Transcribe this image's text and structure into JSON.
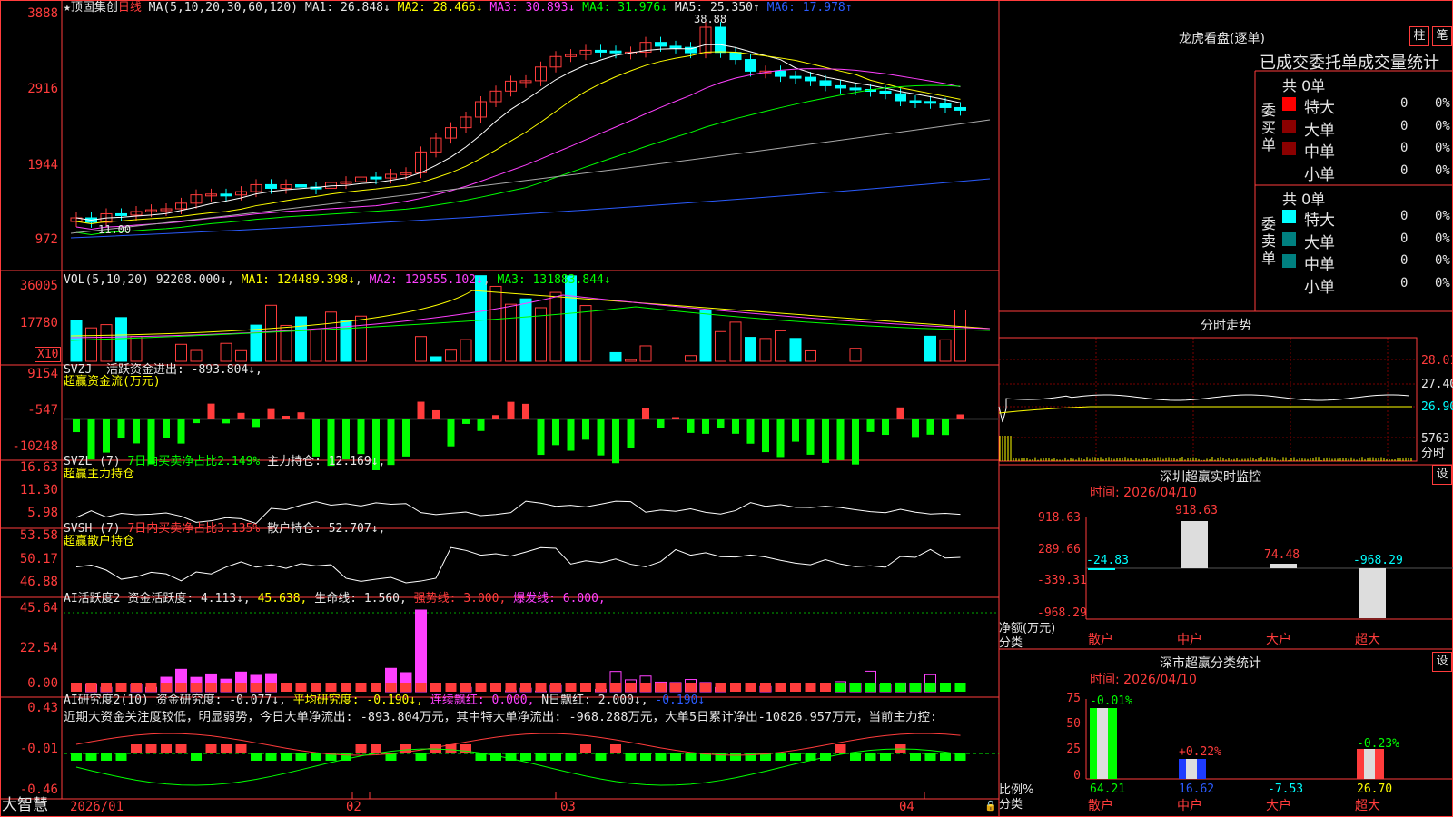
{
  "panel1": {
    "stock": "★顶固集创",
    "period": "日线",
    "ma_params": "MA(5,10,20,30,60,120)",
    "ma1": "MA1: 26.848↓",
    "ma2": "MA2: 28.466↓",
    "ma3": "MA3: 30.893↓",
    "ma4": "MA4: 31.976↓",
    "ma5": "MA5: 25.350↑",
    "ma6": "MA6: 17.978↑",
    "hi_mark": "38.88",
    "lo_mark": "11.00",
    "yticks": [
      "3888",
      "2916",
      "1944",
      "972"
    ]
  },
  "vol": {
    "label": "VOL(5,10,20)",
    "val": "92208.000↓",
    "ma1": "MA1: 124489.398↓",
    "ma2": "MA2: 129555.102↓",
    "ma3": "MA3: 131883.844↓",
    "yticks": [
      "36005",
      "17780"
    ],
    "unit": "X10"
  },
  "svzj": {
    "label": "SVZJ",
    "desc": "活跃资金进出: -893.804↓,",
    "sub": "超赢资金流(万元)",
    "yticks": [
      "9154",
      "-547",
      "-10248"
    ]
  },
  "svzl": {
    "label": "SVZL (7)",
    "desc1": "7日内买卖净占比2.149%",
    "desc2": "主力持仓: 12.169↓,",
    "sub": "超赢主力持仓",
    "yticks": [
      "16.63",
      "11.30",
      "5.98"
    ]
  },
  "svsh": {
    "label": "SVSH (7)",
    "desc1": "7日内买卖净占比3.135%",
    "desc2": "散户持仓: 52.707↓,",
    "sub": "超赢散户持仓",
    "yticks": [
      "53.58",
      "50.17",
      "46.88"
    ]
  },
  "ai1": {
    "label": "AI活跃度2",
    "d1": "资金活跃度: 4.113↓,",
    "d2": "45.638,",
    "d3": "生命线: 1.560,",
    "d4": "强势线: 3.000,",
    "d5": "爆发线: 6.000,",
    "yticks": [
      "45.64",
      "22.54",
      "0.00"
    ]
  },
  "ai2": {
    "label": "AI研究度2(10)",
    "d1": "资金研究度: -0.077↓,",
    "d2": "平均研究度: -0.190↓,",
    "d3": "连续飘红: 0.000,",
    "d4": "N日飘红: 2.000↓,",
    "d5": "-0.190↓",
    "comment": "近期大资金关注度较低，明显弱势，今日大单净流出: -893.804万元，其中特大单净流出: -968.288万元，大单5日累计净出-10826.957万元，当前主力控:",
    "yticks": [
      "0.43",
      "-0.01",
      "-0.46"
    ]
  },
  "xaxis": {
    "labels": [
      "2026/01",
      "02",
      "03",
      "04"
    ]
  },
  "brand": "大智慧",
  "right": {
    "lhb": {
      "title": "龙虎看盘(逐单)",
      "btn1": "柱",
      "btn2": "笔",
      "tabs": "已成交委托单成交量统计",
      "buy_total": "共 0单",
      "sell_total": "共 0单",
      "buy_label": "委买单",
      "sell_label": "委卖单",
      "rows": [
        {
          "name": "特大",
          "v": "0",
          "p": "0%"
        },
        {
          "name": "大单",
          "v": "0",
          "p": "0%"
        },
        {
          "name": "中单",
          "v": "0",
          "p": "0%"
        },
        {
          "name": "小单",
          "v": "0",
          "p": "0%"
        }
      ]
    },
    "intraday": {
      "title": "分时走势",
      "p1": "28.01",
      "p2": "27.40",
      "p3": "26.90",
      "vol": "5763",
      "volunit": "分时"
    },
    "mon": {
      "title": "深圳超赢实时监控",
      "btn": "设",
      "time": "时间: 2026/04/10",
      "yticks": [
        "918.63",
        "289.66",
        "-339.31",
        "-968.29"
      ],
      "ylabel": "净额(万元)",
      "xlabel": "分类",
      "cats": [
        "散户",
        "中户",
        "大户",
        "超大"
      ],
      "vals": [
        "-24.83",
        "918.63",
        "74.48",
        "-968.29"
      ]
    },
    "cls": {
      "title": "深市超赢分类统计",
      "btn": "设",
      "time": "时间: 2026/04/10",
      "yticks": [
        "75",
        "50",
        "25",
        "0"
      ],
      "ylabel": "比例%",
      "xlabel": "分类",
      "cats": [
        "散户",
        "中户",
        "大户",
        "超大"
      ],
      "top": [
        "-0.01%",
        "+0.22%",
        "",
        "-0.23%"
      ],
      "vals": [
        "64.21",
        "16.62",
        "-7.53",
        "26.70"
      ]
    }
  },
  "colors": {
    "up": "#ff3c3c",
    "down": "#00ffff",
    "bg": "#000000",
    "border": "#ff3c3c"
  }
}
